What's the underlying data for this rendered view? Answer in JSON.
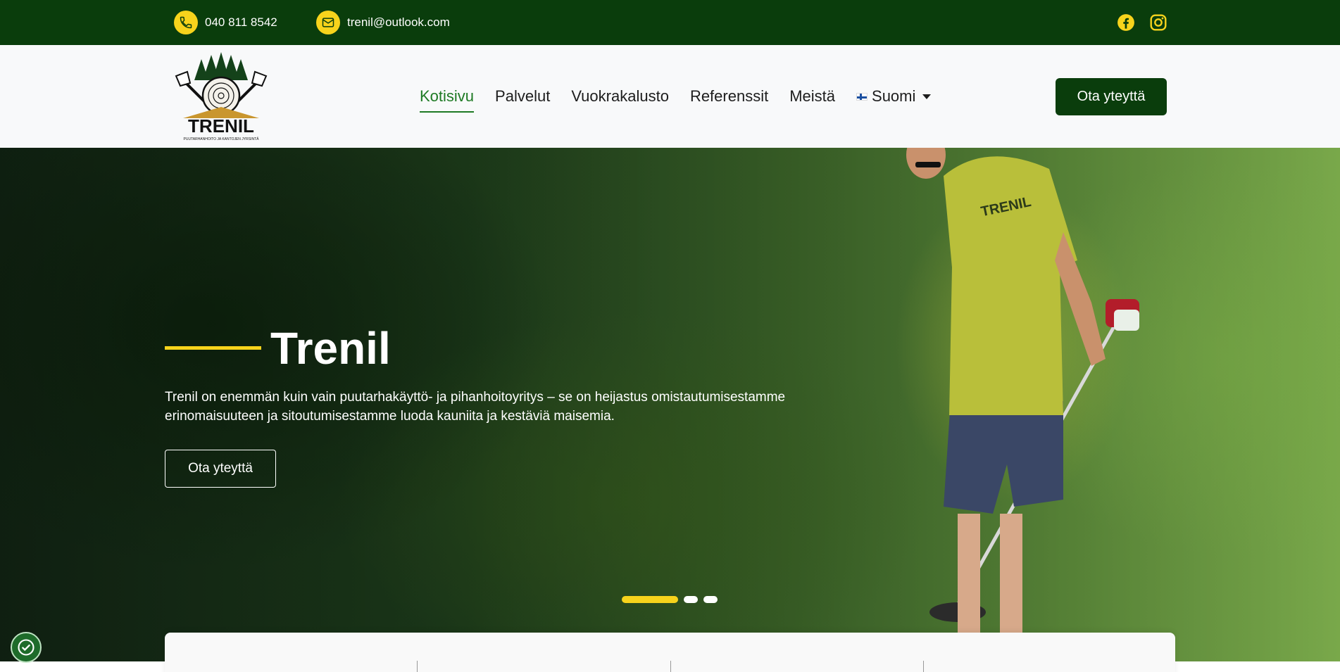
{
  "topbar": {
    "phone": "040 811 8542",
    "email": "trenil@outlook.com",
    "icons": [
      "phone-icon",
      "mail-icon",
      "facebook-icon",
      "instagram-icon"
    ]
  },
  "header": {
    "logo_text": "TRENIL",
    "logo_subtext": "PUUTARHANHOITO JA KANTOJEN JYRSINTÄ",
    "nav": [
      {
        "label": "Kotisivu",
        "active": true
      },
      {
        "label": "Palvelut"
      },
      {
        "label": "Vuokrakalusto"
      },
      {
        "label": "Referenssit"
      },
      {
        "label": "Meistä"
      }
    ],
    "language": "Suomi",
    "cta": "Ota yteyttä"
  },
  "hero": {
    "title": "Trenil",
    "text": "Trenil on enemmän kuin vain puutarhakäyttö- ja pihanhoitoyritys – se on heijastus omistautumisestamme erinomaisuuteen ja sitoutumisestamme luoda kauniita ja kestäviä maisemia.",
    "button": "Ota yteyttä",
    "slides": 3,
    "active_slide": 1,
    "shirt_text": "TRENIL"
  },
  "colors": {
    "dark_green": "#0a3d0c",
    "accent_yellow": "#f7d31c",
    "active_nav": "#1e7a24"
  }
}
